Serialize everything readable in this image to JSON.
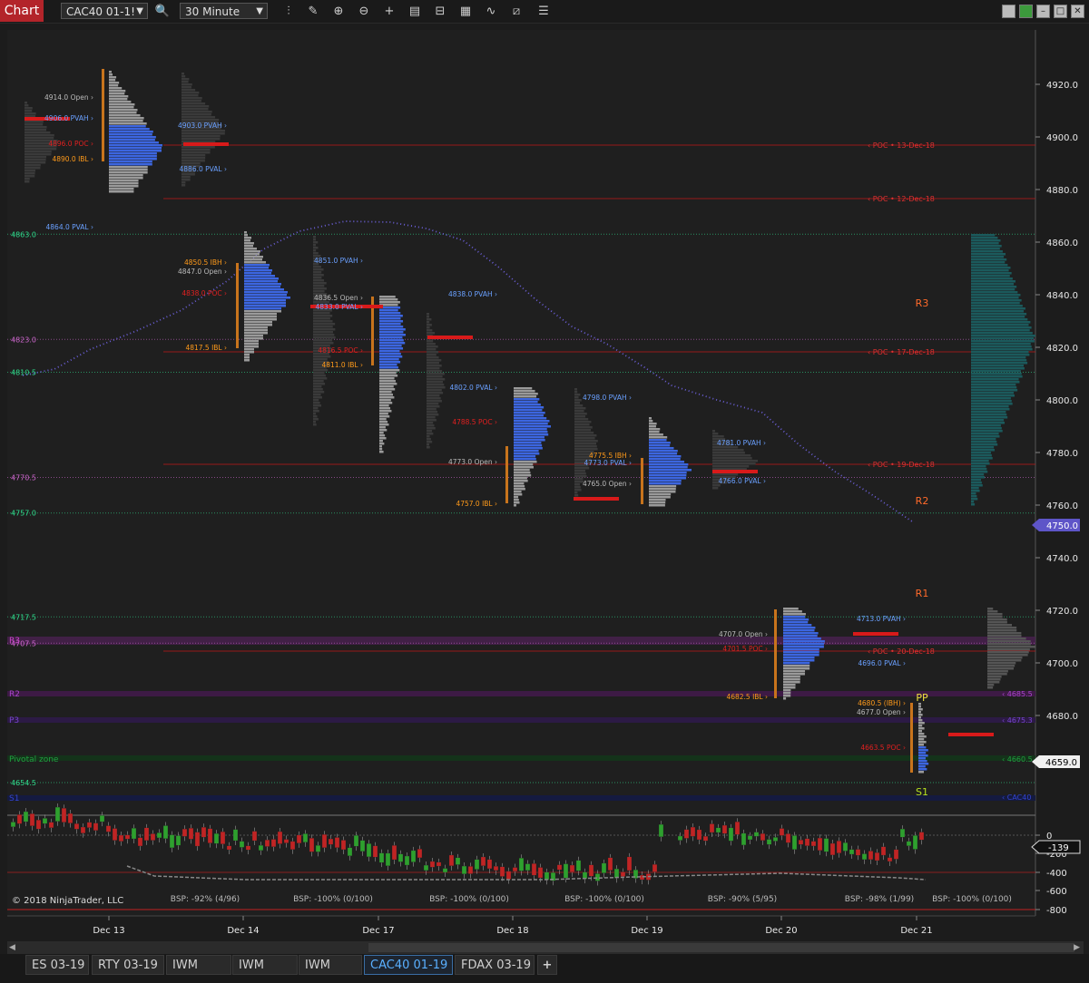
{
  "toolbar": {
    "chart_tab": "Chart",
    "instrument": "CAC40 01-1!",
    "interval": "30 Minute"
  },
  "copyright": "© 2018 NinjaTrader, LLC",
  "tabs": [
    "ES 03-19",
    "RTY 03-19",
    "IWM",
    "IWM",
    "IWM",
    "CAC40 01-19",
    "FDAX 03-19",
    "+"
  ],
  "active_tab": "CAC40 01-19",
  "price_axis": [
    "4920.0",
    "4900.0",
    "4880.0",
    "4860.0",
    "4840.0",
    "4820.0",
    "4800.0",
    "4780.0",
    "4760.0",
    "4740.0",
    "4720.0",
    "4700.0",
    "4680.0"
  ],
  "last_price": "4750.0",
  "cursor_price": "4659.0",
  "indicator_axis": [
    "0",
    "-200",
    "-400",
    "-600",
    "-800"
  ],
  "indicator_value": "-139",
  "dates": [
    "Dec 13",
    "Dec 14",
    "Dec 17",
    "Dec 18",
    "Dec 19",
    "Dec 20",
    "Dec 21"
  ],
  "left_levels": [
    "4863.0",
    "4823.0",
    "4810.5",
    "4770.5",
    "4757.0",
    "4717.5",
    "4707.5",
    "4654.5"
  ],
  "pivots": [
    "R3",
    "R2",
    "R1",
    "PP",
    "S1"
  ],
  "pivot_zone_labels": [
    "R3",
    "R2",
    "P3",
    "Pivotal zone",
    "S1"
  ],
  "pivot_right_labels": [
    "4685.5",
    "4675.3",
    "4660.5",
    "CAC40"
  ],
  "profile_labels": [
    "4914.0 Open",
    "4906.0 PVAH",
    "4896.0 POC",
    "4890.0 IBL",
    "4903.0 PVAH",
    "4886.0 PVAL",
    "4864.0 PVAL",
    "4850.5 IBH",
    "4847.0 Open",
    "4838.0 POC",
    "4817.5 IBL",
    "4851.0 PVAH",
    "4836.5 Open",
    "4833.0 PVAL",
    "4816.5 POC",
    "4811.0 IBL",
    "4838.0 PVAH",
    "4802.0 PVAL",
    "4788.5 POC",
    "4773.0 Open",
    "4757.0 IBL",
    "4798.0 PVAH",
    "4775.5 IBH",
    "4773.0 PVAL",
    "4765.0 Open",
    "4781.0 PVAH",
    "4766.0 PVAL",
    "4707.0 Open",
    "4701.5 POC",
    "4682.5 IBL",
    "4713.0 PVAH",
    "4696.0 PVAL",
    "4680.5 (IBH)",
    "4677.0 Open",
    "4663.5 POC"
  ],
  "poc_labels": [
    "POC • 13-Dec-18",
    "POC • 12-Dec-18",
    "POC • 17-Dec-18",
    "POC • 19-Dec-18",
    "POC • 20-Dec-18"
  ],
  "bsp_labels": [
    "BSP: -92% (4/96)",
    "BSP: -100% (0/100)",
    "BSP: -100% (0/100)",
    "BSP: -100% (0/100)",
    "BSP: -90% (5/95)",
    "BSP: -98% (1/99)",
    "BSP: -100% (0/100)"
  ],
  "colors": {
    "poc": "#e02020",
    "pvah": "#6aa0ff",
    "ibl": "#ff9a1a",
    "profile": "#3c66e0",
    "accent": "#b3242a",
    "vwap": "#6b5fd8"
  }
}
